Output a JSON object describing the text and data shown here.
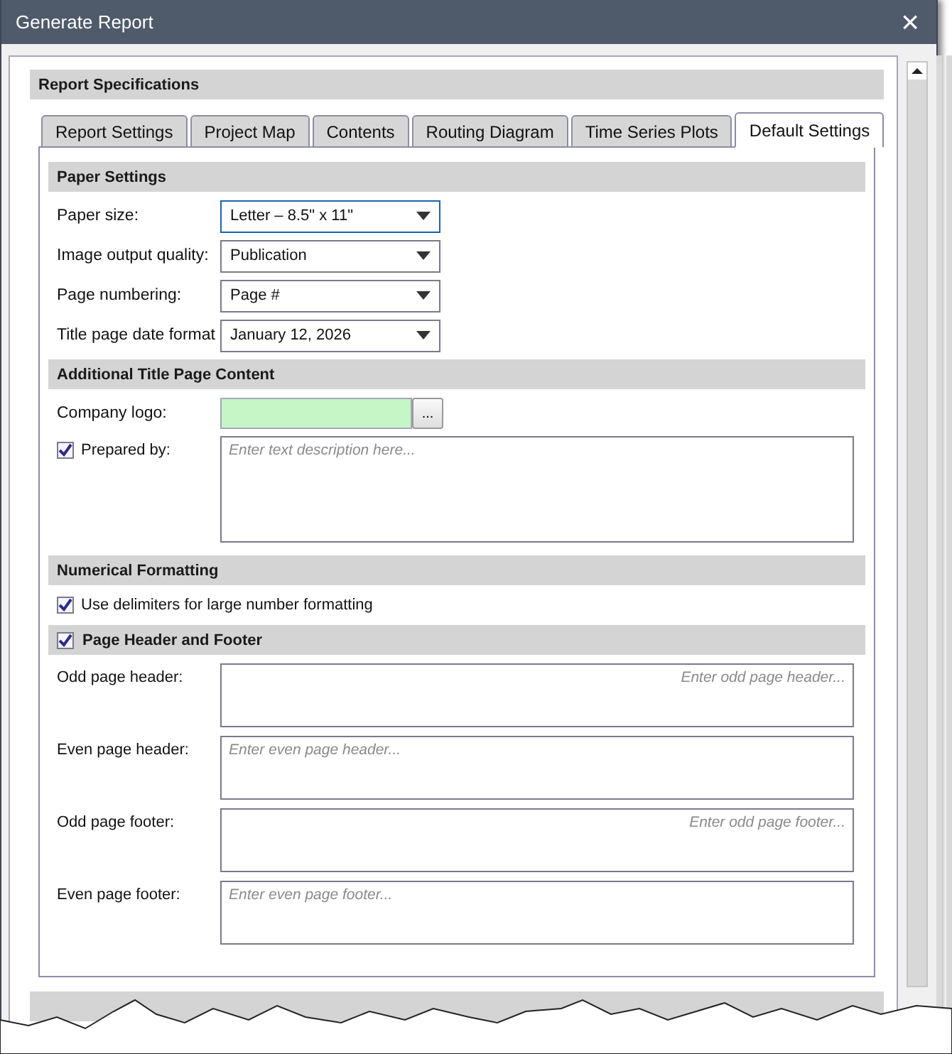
{
  "window": {
    "title": "Generate Report",
    "close": "×"
  },
  "section_title": "Report Specifications",
  "tabs": [
    {
      "label": "Report Settings",
      "selected": false
    },
    {
      "label": "Project Map",
      "selected": false
    },
    {
      "label": "Contents",
      "selected": false
    },
    {
      "label": "Routing Diagram",
      "selected": false
    },
    {
      "label": "Time Series Plots",
      "selected": false
    },
    {
      "label": "Default Settings",
      "selected": true
    }
  ],
  "paper_settings": {
    "title": "Paper Settings",
    "fields": [
      {
        "label": "Paper size:",
        "value": "Letter – 8.5\" x 11\"",
        "focused": true
      },
      {
        "label": "Image output quality:",
        "value": "Publication",
        "focused": false
      },
      {
        "label": "Page numbering:",
        "value": "Page #",
        "focused": false
      },
      {
        "label": "Title page date format",
        "value": "January 12, 2026",
        "focused": false
      }
    ]
  },
  "title_page": {
    "title": "Additional Title Page Content",
    "logo_label": "Company logo:",
    "browse": "...",
    "prepared_by": {
      "label": "Prepared by:",
      "checked": true,
      "placeholder": "Enter text description here..."
    }
  },
  "numerical": {
    "title": "Numerical Formatting",
    "delimiters": {
      "label": "Use delimiters for large number formatting",
      "checked": true
    }
  },
  "header_footer": {
    "title": "Page Header and Footer",
    "checked": true,
    "fields": [
      {
        "label": "Odd page header:",
        "placeholder": "Enter odd page header...",
        "placeholder_right": true
      },
      {
        "label": "Even page header:",
        "placeholder": "Enter even page header...",
        "placeholder_right": false
      },
      {
        "label": "Odd page footer:",
        "placeholder": "Enter odd page footer...",
        "placeholder_right": true
      },
      {
        "label": "Even page footer:",
        "placeholder": "Enter even page footer...",
        "placeholder_right": false
      }
    ]
  }
}
